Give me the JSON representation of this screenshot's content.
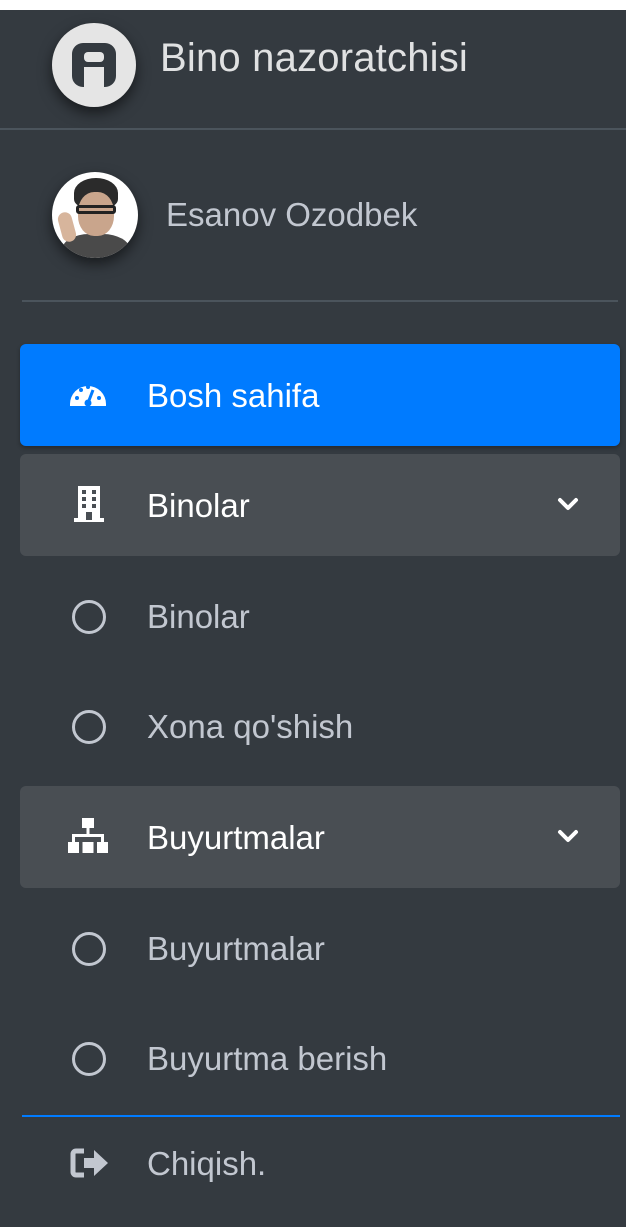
{
  "brand": {
    "title": "Bino nazoratchisi"
  },
  "user": {
    "name": "Esanov Ozodbek"
  },
  "nav": {
    "dashboard": {
      "label": "Bosh sahifa",
      "icon": "tachometer-icon"
    },
    "buildings": {
      "label": "Binolar",
      "icon": "building-icon",
      "children": [
        {
          "label": "Binolar",
          "icon": "circle-icon"
        },
        {
          "label": "Xona qo'shish",
          "icon": "circle-icon"
        }
      ]
    },
    "orders": {
      "label": "Buyurtmalar",
      "icon": "sitemap-icon",
      "children": [
        {
          "label": "Buyurtmalar",
          "icon": "circle-icon"
        },
        {
          "label": "Buyurtma berish",
          "icon": "circle-icon"
        }
      ]
    },
    "logout": {
      "label": "Chiqish.",
      "icon": "sign-out-icon"
    }
  },
  "colors": {
    "sidebar_bg": "#343a40",
    "active_bg": "#007bff",
    "open_bg": "#494e53",
    "text": "#c2c7d0"
  }
}
